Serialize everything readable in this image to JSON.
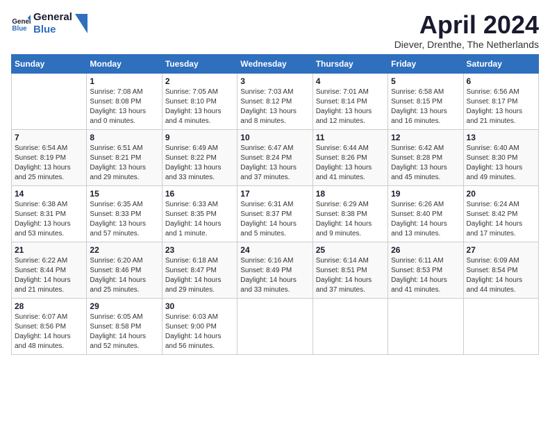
{
  "header": {
    "logo_general": "General",
    "logo_blue": "Blue",
    "month_title": "April 2024",
    "subtitle": "Diever, Drenthe, The Netherlands"
  },
  "calendar": {
    "columns": [
      "Sunday",
      "Monday",
      "Tuesday",
      "Wednesday",
      "Thursday",
      "Friday",
      "Saturday"
    ],
    "rows": [
      [
        {
          "day": "",
          "info": ""
        },
        {
          "day": "1",
          "info": "Sunrise: 7:08 AM\nSunset: 8:08 PM\nDaylight: 13 hours\nand 0 minutes."
        },
        {
          "day": "2",
          "info": "Sunrise: 7:05 AM\nSunset: 8:10 PM\nDaylight: 13 hours\nand 4 minutes."
        },
        {
          "day": "3",
          "info": "Sunrise: 7:03 AM\nSunset: 8:12 PM\nDaylight: 13 hours\nand 8 minutes."
        },
        {
          "day": "4",
          "info": "Sunrise: 7:01 AM\nSunset: 8:14 PM\nDaylight: 13 hours\nand 12 minutes."
        },
        {
          "day": "5",
          "info": "Sunrise: 6:58 AM\nSunset: 8:15 PM\nDaylight: 13 hours\nand 16 minutes."
        },
        {
          "day": "6",
          "info": "Sunrise: 6:56 AM\nSunset: 8:17 PM\nDaylight: 13 hours\nand 21 minutes."
        }
      ],
      [
        {
          "day": "7",
          "info": "Sunrise: 6:54 AM\nSunset: 8:19 PM\nDaylight: 13 hours\nand 25 minutes."
        },
        {
          "day": "8",
          "info": "Sunrise: 6:51 AM\nSunset: 8:21 PM\nDaylight: 13 hours\nand 29 minutes."
        },
        {
          "day": "9",
          "info": "Sunrise: 6:49 AM\nSunset: 8:22 PM\nDaylight: 13 hours\nand 33 minutes."
        },
        {
          "day": "10",
          "info": "Sunrise: 6:47 AM\nSunset: 8:24 PM\nDaylight: 13 hours\nand 37 minutes."
        },
        {
          "day": "11",
          "info": "Sunrise: 6:44 AM\nSunset: 8:26 PM\nDaylight: 13 hours\nand 41 minutes."
        },
        {
          "day": "12",
          "info": "Sunrise: 6:42 AM\nSunset: 8:28 PM\nDaylight: 13 hours\nand 45 minutes."
        },
        {
          "day": "13",
          "info": "Sunrise: 6:40 AM\nSunset: 8:30 PM\nDaylight: 13 hours\nand 49 minutes."
        }
      ],
      [
        {
          "day": "14",
          "info": "Sunrise: 6:38 AM\nSunset: 8:31 PM\nDaylight: 13 hours\nand 53 minutes."
        },
        {
          "day": "15",
          "info": "Sunrise: 6:35 AM\nSunset: 8:33 PM\nDaylight: 13 hours\nand 57 minutes."
        },
        {
          "day": "16",
          "info": "Sunrise: 6:33 AM\nSunset: 8:35 PM\nDaylight: 14 hours\nand 1 minute."
        },
        {
          "day": "17",
          "info": "Sunrise: 6:31 AM\nSunset: 8:37 PM\nDaylight: 14 hours\nand 5 minutes."
        },
        {
          "day": "18",
          "info": "Sunrise: 6:29 AM\nSunset: 8:38 PM\nDaylight: 14 hours\nand 9 minutes."
        },
        {
          "day": "19",
          "info": "Sunrise: 6:26 AM\nSunset: 8:40 PM\nDaylight: 14 hours\nand 13 minutes."
        },
        {
          "day": "20",
          "info": "Sunrise: 6:24 AM\nSunset: 8:42 PM\nDaylight: 14 hours\nand 17 minutes."
        }
      ],
      [
        {
          "day": "21",
          "info": "Sunrise: 6:22 AM\nSunset: 8:44 PM\nDaylight: 14 hours\nand 21 minutes."
        },
        {
          "day": "22",
          "info": "Sunrise: 6:20 AM\nSunset: 8:46 PM\nDaylight: 14 hours\nand 25 minutes."
        },
        {
          "day": "23",
          "info": "Sunrise: 6:18 AM\nSunset: 8:47 PM\nDaylight: 14 hours\nand 29 minutes."
        },
        {
          "day": "24",
          "info": "Sunrise: 6:16 AM\nSunset: 8:49 PM\nDaylight: 14 hours\nand 33 minutes."
        },
        {
          "day": "25",
          "info": "Sunrise: 6:14 AM\nSunset: 8:51 PM\nDaylight: 14 hours\nand 37 minutes."
        },
        {
          "day": "26",
          "info": "Sunrise: 6:11 AM\nSunset: 8:53 PM\nDaylight: 14 hours\nand 41 minutes."
        },
        {
          "day": "27",
          "info": "Sunrise: 6:09 AM\nSunset: 8:54 PM\nDaylight: 14 hours\nand 44 minutes."
        }
      ],
      [
        {
          "day": "28",
          "info": "Sunrise: 6:07 AM\nSunset: 8:56 PM\nDaylight: 14 hours\nand 48 minutes."
        },
        {
          "day": "29",
          "info": "Sunrise: 6:05 AM\nSunset: 8:58 PM\nDaylight: 14 hours\nand 52 minutes."
        },
        {
          "day": "30",
          "info": "Sunrise: 6:03 AM\nSunset: 9:00 PM\nDaylight: 14 hours\nand 56 minutes."
        },
        {
          "day": "",
          "info": ""
        },
        {
          "day": "",
          "info": ""
        },
        {
          "day": "",
          "info": ""
        },
        {
          "day": "",
          "info": ""
        }
      ]
    ]
  }
}
